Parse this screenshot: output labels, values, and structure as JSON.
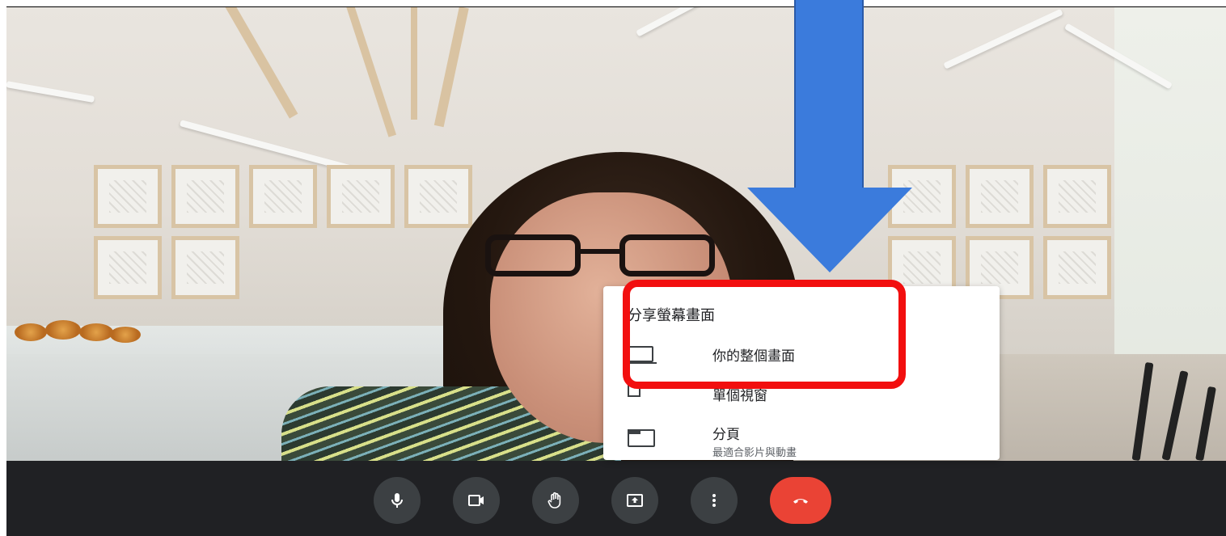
{
  "share_menu": {
    "title": "分享螢幕畫面",
    "options": [
      {
        "label": "你的整個畫面",
        "sublabel": "",
        "icon": "monitor-icon"
      },
      {
        "label": "單個視窗",
        "sublabel": "",
        "icon": "window-icon"
      },
      {
        "label": "分頁",
        "sublabel": "最適合影片與動畫",
        "icon": "tab-icon"
      }
    ]
  },
  "controls": [
    {
      "name": "microphone",
      "icon": "microphone-icon"
    },
    {
      "name": "camera",
      "icon": "camera-icon"
    },
    {
      "name": "raise-hand",
      "icon": "hand-icon"
    },
    {
      "name": "present",
      "icon": "present-screen-icon"
    },
    {
      "name": "more-options",
      "icon": "more-vertical-icon"
    },
    {
      "name": "end-call",
      "icon": "hang-up-icon"
    }
  ],
  "colors": {
    "arrow": "#3b7bdc",
    "highlight": "#f20f0f",
    "control_bar": "#202124",
    "control_button": "#3c4043",
    "end_call": "#ea4335"
  }
}
